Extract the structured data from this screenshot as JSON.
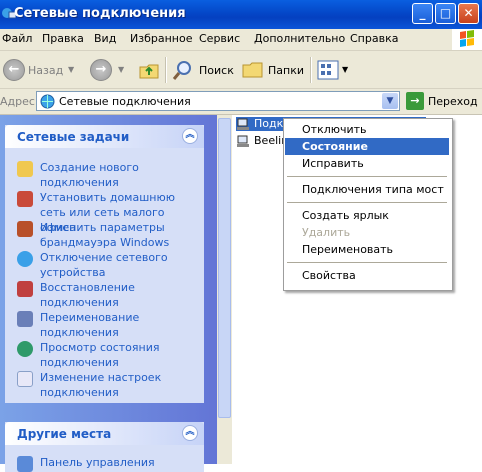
{
  "window": {
    "title": "Сетевые подключения"
  },
  "menu": [
    "Файл",
    "Правка",
    "Вид",
    "Избранное",
    "Сервис",
    "Дополнительно",
    "Справка"
  ],
  "toolbar": {
    "back": "Назад",
    "search": "Поиск",
    "folders": "Папки"
  },
  "address": {
    "label": "Адрес:",
    "value": "Сетевые подключения",
    "go": "Переход"
  },
  "left_panel": {
    "network_tasks": {
      "title": "Сетевые задачи",
      "items": [
        {
          "label": "Создание нового подключения",
          "icon": "new-connection-icon"
        },
        {
          "label": "Установить домашнюю сеть или сеть малого офиса",
          "icon": "home-network-icon"
        },
        {
          "label": "Изменить параметры брандмауэра Windows",
          "icon": "firewall-icon"
        },
        {
          "label": "Отключение сетевого устройства",
          "icon": "disable-device-icon"
        },
        {
          "label": "Восстановление подключения",
          "icon": "repair-icon"
        },
        {
          "label": "Переименование подключения",
          "icon": "rename-icon"
        },
        {
          "label": "Просмотр состояния подключения",
          "icon": "status-icon"
        },
        {
          "label": "Изменение настроек подключения",
          "icon": "settings-icon"
        }
      ]
    },
    "other_places": {
      "title": "Другие места",
      "items": [
        "Панель управления"
      ]
    }
  },
  "connections": [
    "Подкл",
    "Beeline"
  ],
  "context_menu": {
    "items": [
      "Отключить",
      "Состояние",
      "Исправить",
      "Подключения типа мост",
      "Создать ярлык",
      "Удалить",
      "Переименовать",
      "Свойства"
    ],
    "selected": "Состояние",
    "disabled": [
      "Удалить"
    ]
  },
  "colors": {
    "title_bar": "#0a5fe0",
    "task_link": "#215dc6",
    "menu_highlight": "#316ac5",
    "sidebar": "#7ba2e7"
  }
}
